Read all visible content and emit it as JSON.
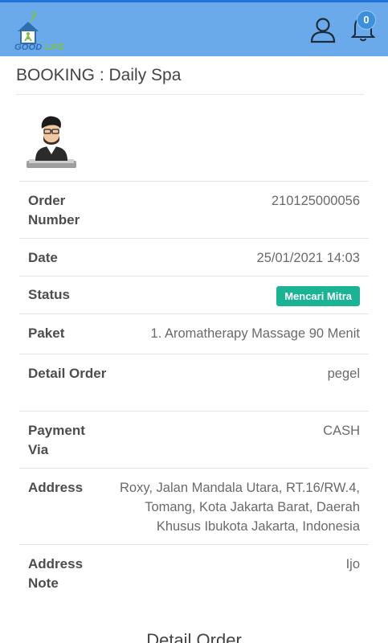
{
  "header": {
    "logo_text_1": "GOOD",
    "logo_text_2": "LIFE",
    "notification_count": "0",
    "icons": {
      "user": "user-icon",
      "notification": "bell-icon"
    },
    "colors": {
      "bar": "#6aaaea",
      "accent": "#1f74d8"
    }
  },
  "page": {
    "title": "BOOKING : Daily Spa"
  },
  "details": {
    "order_number_label": "Order Number",
    "order_number": "210125000056",
    "date_label": "Date",
    "date": "25/01/2021 14:03",
    "status_label": "Status",
    "status": "Mencari Mitra",
    "status_color": "#1ab394",
    "paket_label": "Paket",
    "paket": "1. Aromatherapy Massage 90 Menit",
    "detail_order_label": "Detail Order",
    "detail_order": "pegel",
    "payment_label": "Payment Via",
    "payment": "CASH",
    "address_label": "Address",
    "address": "Roxy, Jalan Mandala Utara, RT.16/RW.4, Tomang, Kota Jakarta Barat, Daerah Khusus Ibukota Jakarta, Indonesia",
    "address_note_label": "Address Note",
    "address_note": "Ijo"
  },
  "section": {
    "detail_order_title": "Detail Order"
  }
}
